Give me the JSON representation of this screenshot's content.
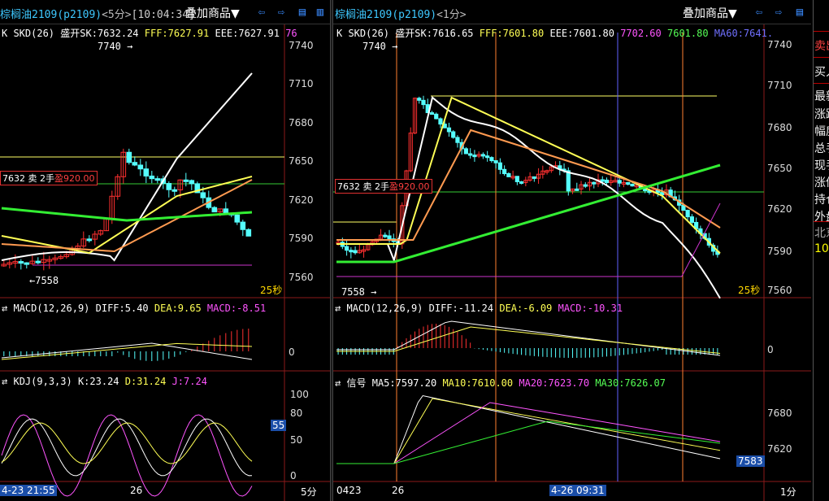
{
  "left": {
    "symbol": "棕榈油2109",
    "code": "(p2109)",
    "period": "<5分>",
    "time": "[10:04:34]",
    "overlay_label": "叠加商品▼",
    "legend": {
      "name": "K SKD(26)",
      "sk": "盛开SK:7632.24",
      "fff": "FFF:7627.91",
      "eee": "EEE:7627.91",
      "tail": "76"
    },
    "price_axis": [
      "7740",
      "7710",
      "7680",
      "7650",
      "7620",
      "7590",
      "7560"
    ],
    "high_note": "7740",
    "low_note": "←7558",
    "order": {
      "price": "7632",
      "side": "卖",
      "qty": "2手",
      "pl": "盈920.00"
    },
    "countdown": "25秒",
    "macd_legend": {
      "name": "MACD(12,26,9)",
      "diff": "DIFF:5.40",
      "dea": "DEA:9.65",
      "macd": "MACD:-8.51"
    },
    "macd_axis": [
      "0"
    ],
    "kdj_legend": {
      "name": "KDJ(9,3,3)",
      "k": "K:23.24",
      "d": "D:31.24",
      "j": "J:7.24"
    },
    "kdj_axis": [
      "100",
      "80",
      "50",
      "0"
    ],
    "kdj_badge": "55",
    "bottom": {
      "time": "4-23 21:55",
      "mark": "26",
      "period": "5分"
    }
  },
  "right": {
    "symbol": "棕榈油2109",
    "code": "(p2109)",
    "period": "<1分>",
    "overlay_label": "叠加商品▼",
    "legend": {
      "name": "K SKD(26)",
      "sk": "盛开SK:7616.65",
      "fff": "FFF:7601.80",
      "eee": "EEE:7601.80",
      "v1": "7702.60",
      "v2": "7601.80",
      "ma60": "MA60:7641."
    },
    "price_axis": [
      "7740",
      "7710",
      "7680",
      "7650",
      "7620",
      "7590",
      "7560"
    ],
    "high_note": "7740",
    "low_note": "7558",
    "order": {
      "price": "7632",
      "side": "卖",
      "qty": "2手",
      "pl": "盈920.00"
    },
    "countdown": "25秒",
    "macd_legend": {
      "name": "MACD(12,26,9)",
      "diff": "DIFF:-11.24",
      "dea": "DEA:-6.09",
      "macd": "MACD:-10.31"
    },
    "macd_axis": [
      "0"
    ],
    "sig_legend": {
      "name": "信号",
      "ma5": "MA5:7597.20",
      "ma10": "MA10:7610.00",
      "ma20": "MA20:7623.70",
      "ma30": "MA30:7626.07"
    },
    "sig_axis": [
      "7680",
      "7620"
    ],
    "sig_badge": "7583",
    "bottom": {
      "date": "0423",
      "mark": "26",
      "time": "4-26 09:31",
      "period": "1分"
    }
  },
  "side_panel": {
    "items": [
      "卖出",
      "买入",
      "最新",
      "涨跌",
      "幅度",
      "总手",
      "现手",
      "涨停",
      "持仓",
      "外盘",
      "北京",
      "10:"
    ]
  }
}
